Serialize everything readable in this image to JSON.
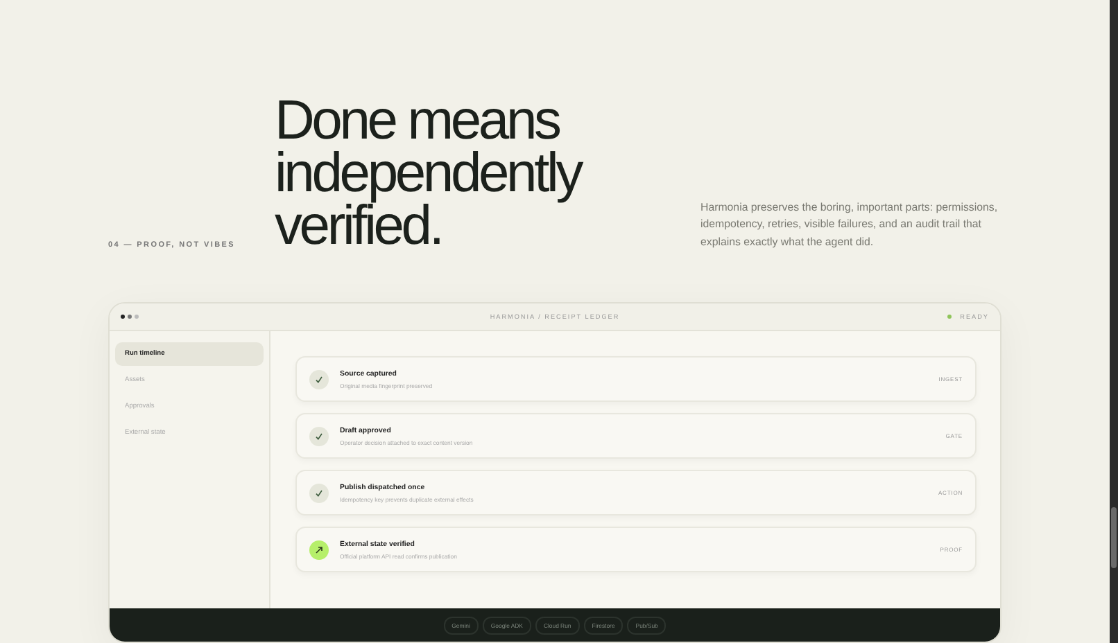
{
  "hero": {
    "eyebrow": "04 — PROOF, NOT VIBES",
    "heading": [
      "Done means",
      "independently",
      "verified."
    ],
    "body": "Harmonia preserves the boring, important parts: permissions, idempotency, retries, visible failures, and an audit trail that explains exactly what the agent did."
  },
  "window": {
    "title": "HARMONIA / RECEIPT LEDGER",
    "status": "READY"
  },
  "sidebar": {
    "items": [
      {
        "label": "Run timeline",
        "selected": true
      },
      {
        "label": "Assets",
        "selected": false
      },
      {
        "label": "Approvals",
        "selected": false
      },
      {
        "label": "External state",
        "selected": false
      }
    ]
  },
  "steps": [
    {
      "title": "Source captured",
      "detail": "Original media fingerprint preserved",
      "tag": "INGEST",
      "kind": "done"
    },
    {
      "title": "Draft approved",
      "detail": "Operator decision attached to exact content version",
      "tag": "GATE",
      "kind": "done"
    },
    {
      "title": "Publish dispatched once",
      "detail": "Idempotency key prevents duplicate external effects",
      "tag": "ACTION",
      "kind": "done"
    },
    {
      "title": "External state verified",
      "detail": "Official platform API read confirms publication",
      "tag": "PROOF",
      "kind": "verified"
    }
  ],
  "footer": {
    "chips": [
      "Gemini",
      "Google ADK",
      "Cloud Run",
      "Firestore",
      "Pub/Sub"
    ]
  }
}
